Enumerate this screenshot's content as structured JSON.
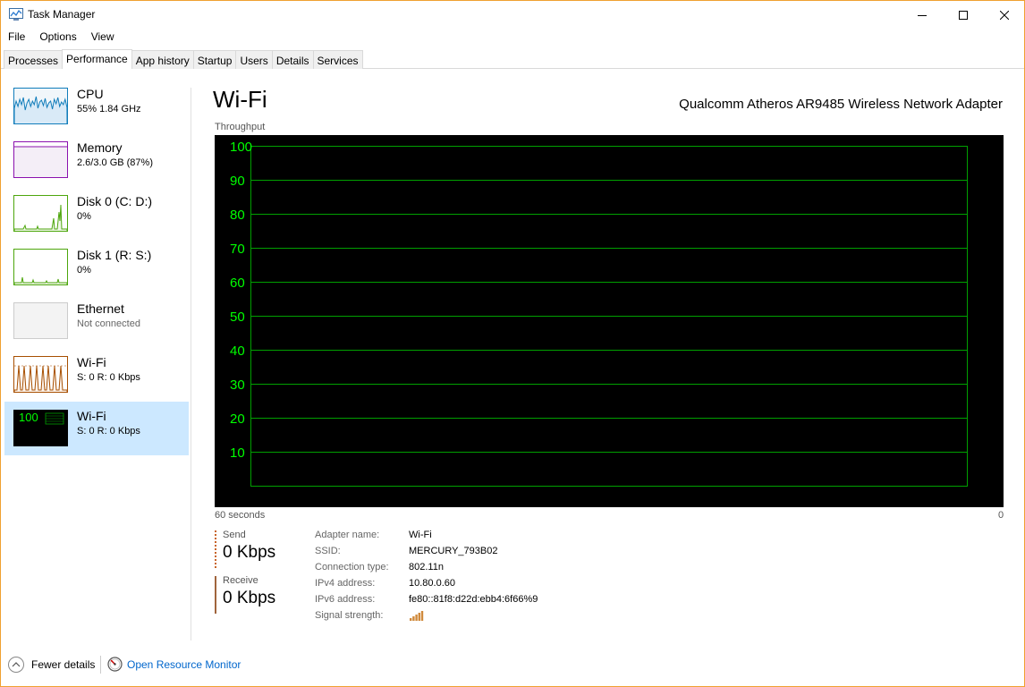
{
  "window": {
    "title": "Task Manager"
  },
  "menu": [
    "File",
    "Options",
    "View"
  ],
  "tabs": [
    "Processes",
    "Performance",
    "App history",
    "Startup",
    "Users",
    "Details",
    "Services"
  ],
  "active_tab": "Performance",
  "sidebar": {
    "items": [
      {
        "name": "CPU",
        "sub": "55%  1.84 GHz",
        "color": "#117dbb"
      },
      {
        "name": "Memory",
        "sub": "2.6/3.0 GB (87%)",
        "color": "#8b12ae"
      },
      {
        "name": "Disk 0 (C: D:)",
        "sub": "0%",
        "color": "#4da60c"
      },
      {
        "name": "Disk 1 (R: S:)",
        "sub": "0%",
        "color": "#4da60c"
      },
      {
        "name": "Ethernet",
        "sub": "Not connected",
        "color": "#a74f01"
      },
      {
        "name": "Wi-Fi",
        "sub": "S: 0  R: 0 Kbps",
        "color": "#a74f01"
      },
      {
        "name": "Wi-Fi",
        "sub": "S: 0  R: 0 Kbps",
        "color": "#00ff00",
        "thumb_label": "100"
      }
    ]
  },
  "main": {
    "title": "Wi-Fi",
    "adapter": "Qualcomm Atheros AR9485 Wireless Network Adapter",
    "chart_caption": "Throughput",
    "x_left_label": "60 seconds",
    "x_right_label": "0"
  },
  "chart_data": {
    "type": "line",
    "title": "",
    "ylabel": "Throughput",
    "xlabel": "",
    "ylim": [
      0,
      100
    ],
    "yticks": [
      100,
      90,
      80,
      70,
      60,
      50,
      40,
      30,
      20,
      10
    ],
    "grid": true,
    "background": "#000000",
    "grid_color": "#00a000",
    "tick_color": "#00ff00",
    "x_range_seconds": [
      60,
      0
    ],
    "series": []
  },
  "stats": {
    "send_label": "Send",
    "send_value": "0 Kbps",
    "receive_label": "Receive",
    "receive_value": "0 Kbps"
  },
  "properties": [
    {
      "key": "Adapter name:",
      "value": "Wi-Fi"
    },
    {
      "key": "SSID:",
      "value": "MERCURY_793B02"
    },
    {
      "key": "Connection type:",
      "value": "802.11n"
    },
    {
      "key": "IPv4 address:",
      "value": "10.80.0.60"
    },
    {
      "key": "IPv6 address:",
      "value": "fe80::81f8:d22d:ebb4:6f66%9"
    },
    {
      "key": "Signal strength:",
      "value": ""
    }
  ],
  "signal_strength_bars": 5,
  "footer": {
    "fewer_details": "Fewer details",
    "open_resource_monitor": "Open Resource Monitor"
  }
}
